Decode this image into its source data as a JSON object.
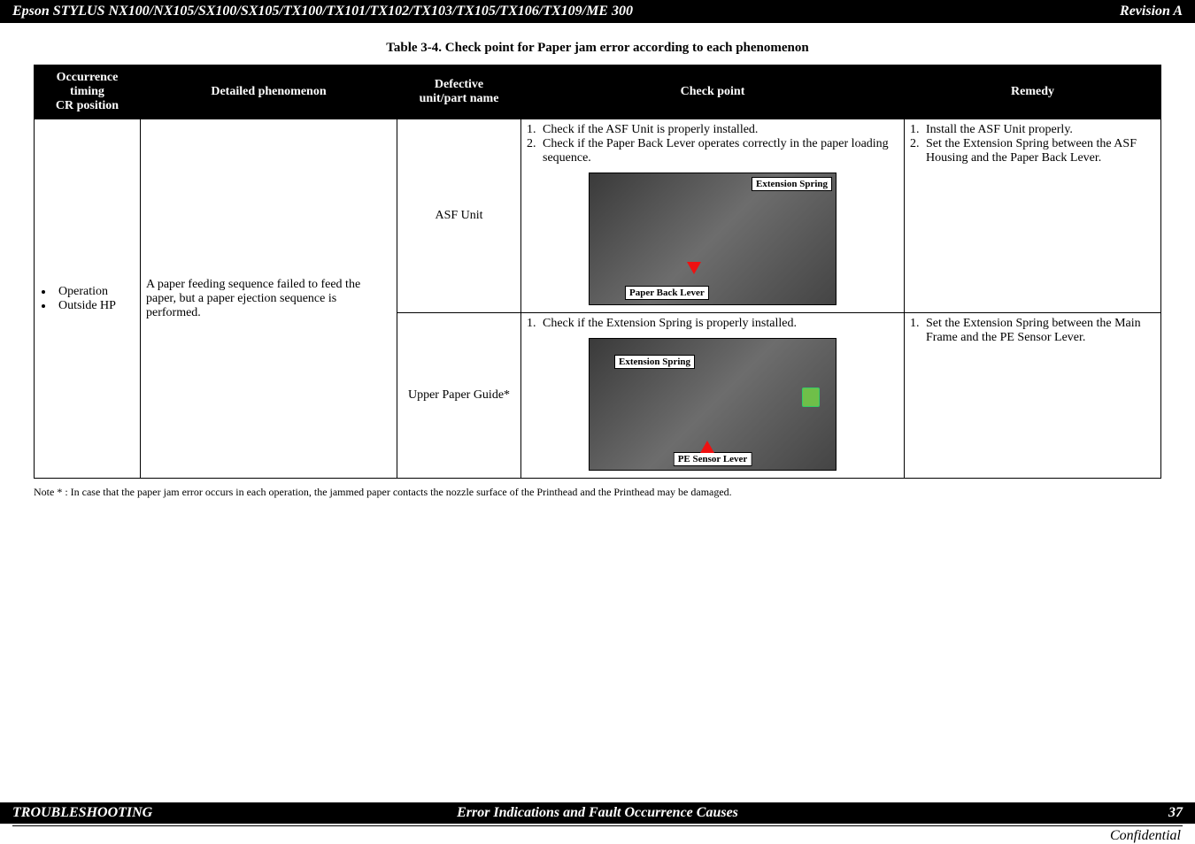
{
  "header": {
    "left": "Epson STYLUS NX100/NX105/SX100/SX105/TX100/TX101/TX102/TX103/TX105/TX106/TX109/ME 300",
    "right": "Revision A"
  },
  "table_title": "Table 3-4.  Check point for Paper jam error according to each phenomenon",
  "columns": {
    "occurrence": "Occurrence timing\nCR position",
    "detailed": "Detailed phenomenon",
    "defective": "Defective unit/part name",
    "check": "Check point",
    "remedy": "Remedy"
  },
  "row": {
    "occurrence_items": [
      "Operation",
      "Outside HP"
    ],
    "detailed": "A paper feeding sequence failed to feed the paper, but a paper ejection sequence is performed.",
    "unit1": "ASF Unit",
    "unit2": "Upper Paper Guide*",
    "check1_items": [
      "Check if the ASF Unit is properly installed.",
      "Check if the Paper Back Lever operates correctly in the paper loading sequence."
    ],
    "check1_labels": {
      "ext": "Extension Spring",
      "pbl": "Paper Back Lever"
    },
    "check2_items": [
      "Check if the Extension Spring is properly installed."
    ],
    "check2_labels": {
      "ext": "Extension Spring",
      "pes": "PE Sensor Lever"
    },
    "remedy1_items": [
      "Install the ASF Unit properly.",
      "Set the Extension Spring between the ASF Housing and the Paper Back Lever."
    ],
    "remedy2_items": [
      "Set the Extension Spring between the Main Frame and the PE Sensor Lever."
    ]
  },
  "note": "Note * :  In case that the paper jam error occurs in each operation, the jammed paper contacts the nozzle surface of the Printhead and the Printhead may be damaged.",
  "footer": {
    "left": "TROUBLESHOOTING",
    "center": "Error Indications and Fault Occurrence Causes",
    "right": "37",
    "confidential": "Confidential"
  }
}
